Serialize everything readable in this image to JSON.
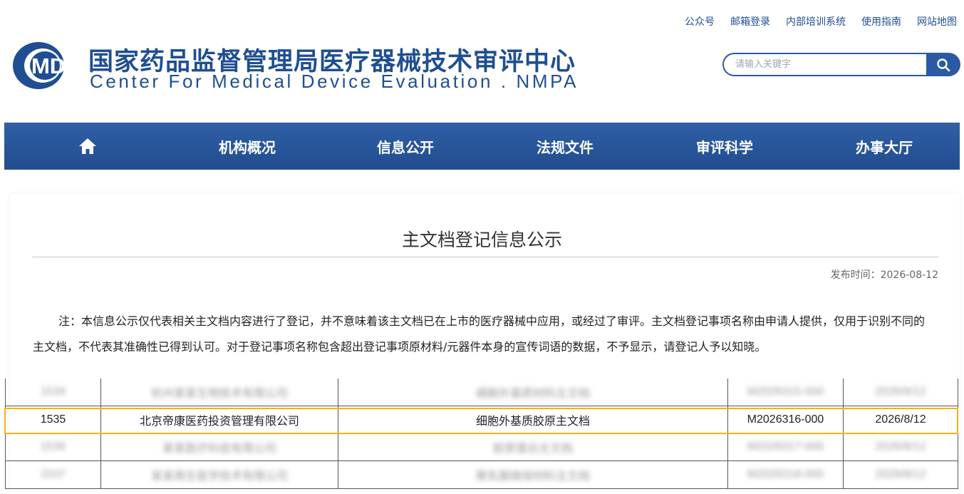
{
  "top_links": [
    "公众号",
    "邮箱登录",
    "内部培训系统",
    "使用指南",
    "网站地图"
  ],
  "site": {
    "logo_text": "MDE",
    "title_cn": "国家药品监督管理局医疗器械技术审评中心",
    "title_en": "Center For Medical Device Evaluation . NMPA"
  },
  "search": {
    "placeholder": "请输入关键字",
    "icon": "search-icon"
  },
  "nav": {
    "home_icon": "home-icon",
    "items": [
      "机构概况",
      "信息公开",
      "法规文件",
      "审评科学",
      "办事大厅"
    ]
  },
  "colors": {
    "brand": "#1f4e92",
    "nav_bg": "#2a5aa3",
    "highlight": "#f1b21c"
  },
  "page": {
    "title": "主文档登记信息公示",
    "publish_label": "发布时间：",
    "publish_date": "2026-08-12",
    "note": "注：本信息公示仅代表相关主文档内容进行了登记，并不意味着该主文档已在上市的医疗器械中应用，或经过了审评。主文档登记事项名称由申请人提供，仅用于识别不同的主文档，不代表其准确性已得到认可。对于登记事项名称包含超出登记事项原材料/元器件本身的宣传词语的数据，不予显示，请登记人予以知晓。"
  },
  "table": {
    "rows": [
      {
        "blurred": true,
        "cells": [
          "1534",
          "杭州某某生物技术有限公司",
          "细胞外基质材料主文档",
          "M2026315-000",
          "2026/8/12"
        ]
      },
      {
        "blurred": false,
        "cells": [
          "1535",
          "北京帝康医药投资管理有限公司",
          "细胞外基质胶原主文档",
          "M2026316-000",
          "2026/8/12"
        ]
      },
      {
        "blurred": true,
        "cells": [
          "1536",
          "某某医疗科技有限公司",
          "胶原蛋白主文档",
          "M2026317-000",
          "2026/8/12"
        ]
      },
      {
        "blurred": true,
        "cells": [
          "1537",
          "某某再生医学技术有限公司",
          "聚乳酸微球材料主文档",
          "M2026318-000",
          "2026/8/12"
        ]
      }
    ]
  }
}
